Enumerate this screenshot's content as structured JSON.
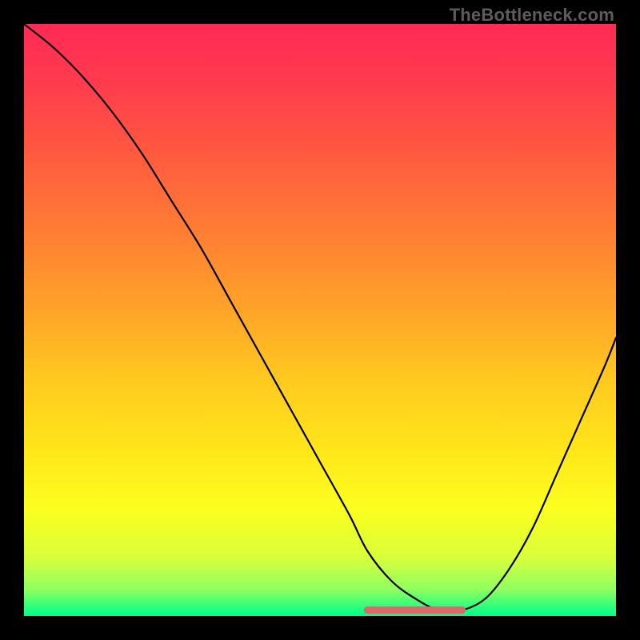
{
  "watermark": {
    "text": "TheBottleneck.com"
  },
  "gradient": {
    "stops": [
      {
        "offset": 0.0,
        "color": "#ff2a55"
      },
      {
        "offset": 0.1,
        "color": "#ff3b4e"
      },
      {
        "offset": 0.22,
        "color": "#ff5a3f"
      },
      {
        "offset": 0.35,
        "color": "#ff7d33"
      },
      {
        "offset": 0.48,
        "color": "#ffa329"
      },
      {
        "offset": 0.6,
        "color": "#ffc91f"
      },
      {
        "offset": 0.72,
        "color": "#ffe61a"
      },
      {
        "offset": 0.82,
        "color": "#fbff1e"
      },
      {
        "offset": 0.9,
        "color": "#d9ff3a"
      },
      {
        "offset": 0.955,
        "color": "#8fff60"
      },
      {
        "offset": 0.985,
        "color": "#2bff7e"
      },
      {
        "offset": 1.0,
        "color": "#00ff88"
      }
    ]
  },
  "chart_data": {
    "type": "line",
    "title": "",
    "xlabel": "",
    "ylabel": "",
    "xlim": [
      0,
      100
    ],
    "ylim": [
      0,
      100
    ],
    "x": [
      0,
      5,
      10,
      15,
      20,
      25,
      30,
      35,
      40,
      45,
      50,
      55,
      58,
      62,
      66,
      70,
      74,
      78,
      82,
      86,
      90,
      94,
      98,
      100
    ],
    "values": [
      100,
      96,
      91,
      85,
      78,
      70,
      62,
      53,
      44,
      35,
      26,
      17,
      11,
      6,
      3,
      1,
      1,
      3,
      8,
      15,
      24,
      33,
      42,
      47
    ],
    "minimum_band": {
      "x_start": 58,
      "x_end": 74,
      "y": 1
    },
    "minimum_marker_color": "#d86a6a"
  }
}
